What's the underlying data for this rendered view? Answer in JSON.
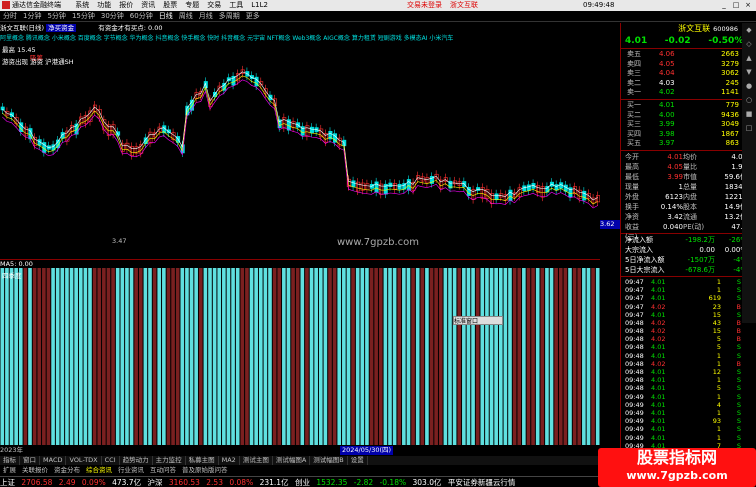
{
  "titlebar": {
    "app_title": "通达信金融终端",
    "menus": [
      "系统",
      "功能",
      "报价",
      "资讯",
      "股票",
      "专题",
      "交易",
      "工具",
      "L1L2"
    ],
    "alert1": "交易未登录",
    "alert2": "浙文互联",
    "time": "09:49:48",
    "win_buttons": [
      "行情",
      "资讯",
      "交易",
      "服务"
    ]
  },
  "menubar": {
    "items": [
      "分时",
      "1分钟",
      "5分钟",
      "15分钟",
      "30分钟",
      "60分钟",
      "日线",
      "周线",
      "月线",
      "多周期",
      "更多"
    ],
    "active": "日线"
  },
  "chart_header": {
    "name": "浙文互联(日线)",
    "tag": "净买资金",
    "indicator": "有资金才有买点: 0.00"
  },
  "concepts": "阿里概念 腾讯概念 小米概念 百度概念 字节概念 华为概念 抖音概念 快手概念 快时 抖音概念 元宇宙 NFT概念 Web3概念 AIGC概念 算力租赁 短剧游戏 多模态AI 小米汽车",
  "left_labels": {
    "top1": "最高 15.45",
    "top2": "吸筹",
    "top3": "游资",
    "top4": "游资出现 游资 沪港通SH",
    "low_label": "3.47",
    "axis_value": "3.62"
  },
  "watermark": "www.7gpzb.com",
  "lower": {
    "header": "MA5: 0.00",
    "left_label": "四季度"
  },
  "right_panel": {
    "stock_name": "浙文互联",
    "code": "600986",
    "price": "4.01",
    "change": "-0.02",
    "pct": "-0.50%",
    "asks": [
      {
        "l": "卖五",
        "p": "4.06",
        "v": "2663"
      },
      {
        "l": "卖四",
        "p": "4.05",
        "v": "3279"
      },
      {
        "l": "卖三",
        "p": "4.04",
        "v": "3062"
      },
      {
        "l": "卖二",
        "p": "4.03",
        "v": "245"
      },
      {
        "l": "卖一",
        "p": "4.02",
        "v": "1141"
      }
    ],
    "bids": [
      {
        "l": "买一",
        "p": "4.01",
        "v": "779"
      },
      {
        "l": "买二",
        "p": "4.00",
        "v": "9436"
      },
      {
        "l": "买三",
        "p": "3.99",
        "v": "3049"
      },
      {
        "l": "买四",
        "p": "3.98",
        "v": "1867"
      },
      {
        "l": "买五",
        "p": "3.97",
        "v": "863"
      }
    ],
    "info": [
      [
        "今开",
        "4.01",
        "均价",
        "4.02"
      ],
      [
        "最高",
        "4.05",
        "量比",
        "1.92"
      ],
      [
        "最低",
        "3.99",
        "市值",
        "59.6亿"
      ],
      [
        "现量",
        "1",
        "总量",
        "18341"
      ],
      [
        "外盘",
        "6123",
        "内盘",
        "12218"
      ],
      [
        "换手",
        "0.14%",
        "股本",
        "14.9亿"
      ],
      [
        "净资",
        "3.42",
        "流通",
        "13.2亿"
      ],
      [
        "收益(三)",
        "0.040",
        "PE(动)",
        "47.5"
      ]
    ],
    "flows": [
      [
        "净流入额",
        "-198.2万",
        "-26%"
      ],
      [
        "大宗流入",
        "0.00",
        "0.00%"
      ],
      [
        "5日净流入额",
        "-1507万",
        "-4%"
      ],
      [
        "5日大宗流入",
        "-678.6万",
        "-4%"
      ]
    ],
    "ticks": [
      [
        "09:47",
        "4.01",
        "1",
        "S"
      ],
      [
        "09:47",
        "4.01",
        "1",
        "S"
      ],
      [
        "09:47",
        "4.01",
        "619",
        "S"
      ],
      [
        "09:47",
        "4.02",
        "23",
        "B"
      ],
      [
        "09:47",
        "4.01",
        "15",
        "S"
      ],
      [
        "09:48",
        "4.02",
        "43",
        "B"
      ],
      [
        "09:48",
        "4.02",
        "15",
        "B"
      ],
      [
        "09:48",
        "4.02",
        "5",
        "B"
      ],
      [
        "09:48",
        "4.01",
        "5",
        "S"
      ],
      [
        "09:48",
        "4.01",
        "1",
        "S"
      ],
      [
        "09:48",
        "4.02",
        "1",
        "B"
      ],
      [
        "09:48",
        "4.01",
        "12",
        "S"
      ],
      [
        "09:48",
        "4.01",
        "1",
        "S"
      ],
      [
        "09:48",
        "4.01",
        "5",
        "S"
      ],
      [
        "09:49",
        "4.01",
        "1",
        "S"
      ],
      [
        "09:49",
        "4.01",
        "4",
        "S"
      ],
      [
        "09:49",
        "4.01",
        "1",
        "S"
      ],
      [
        "09:49",
        "4.01",
        "93",
        "S"
      ],
      [
        "09:49",
        "4.01",
        "1",
        "S"
      ],
      [
        "09:49",
        "4.01",
        "1",
        "S"
      ],
      [
        "09:49",
        "4.01",
        "7",
        "S"
      ],
      [
        "09:49",
        "4.02",
        "13",
        "B"
      ],
      [
        "09:49",
        "4.01",
        "4",
        "S"
      ],
      [
        "09:49",
        "4.01",
        "1",
        "S"
      ],
      [
        "09:49",
        "4.01",
        "8",
        "S"
      ],
      [
        "09:49",
        "4.01",
        "23",
        "S"
      ]
    ]
  },
  "date_bar": {
    "left": "2023年",
    "hl": "2024/05/30(四)"
  },
  "tabs": [
    "指标",
    "窗口",
    "MACD",
    "VOL-TDX",
    "CCI",
    "趋势动力",
    "主力监控",
    "私募主图",
    "MA2",
    "测试主图",
    "测试幅图A",
    "测试幅图B",
    "设置"
  ],
  "tabs2": [
    "扩展",
    "关联报价",
    "资金分布",
    "综合资讯",
    "行业资讯",
    "互动问答",
    "普及原始版问答"
  ],
  "status": {
    "sh_label": "上证",
    "sh_val": "2706.58",
    "sh_chg": "2.49",
    "sh_pct": "0.09%",
    "sh_amt": "473.7亿",
    "sz_label": "沪深",
    "sz_val": "3160.53",
    "sz_chg": "2.53",
    "sz_pct": "0.08%",
    "sz_amt": "231.1亿",
    "cy_label": "创业",
    "cy_val": "1532.35",
    "cy_chg": "-2.82",
    "cy_pct": "-0.18%",
    "cy_amt": "303.0亿",
    "note": "平安证券新疆云行情"
  },
  "brand": {
    "line1": "股票指标网",
    "line2": "www.7gpzb.com"
  },
  "popup": "标准窗口",
  "colors": {
    "up": "#ff3030",
    "down": "#00e0e0",
    "bg": "#000000"
  }
}
